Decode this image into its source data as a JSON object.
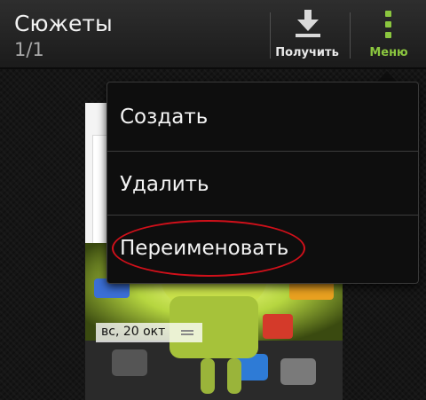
{
  "header": {
    "title": "Сюжеты",
    "subtitle": "1/1",
    "actions": [
      {
        "label": "Получить",
        "icon": "download-icon"
      },
      {
        "label": "Меню",
        "icon": "menu-dots-icon"
      }
    ]
  },
  "menu": {
    "items": [
      {
        "label": "Создать"
      },
      {
        "label": "Удалить"
      },
      {
        "label": "Переименовать"
      }
    ]
  },
  "story": {
    "date": "вс, 20 окт"
  },
  "colors": {
    "accent_green": "#8bc63f",
    "highlight_red": "#d0101a",
    "bar_dark": "#1b1b1b"
  }
}
